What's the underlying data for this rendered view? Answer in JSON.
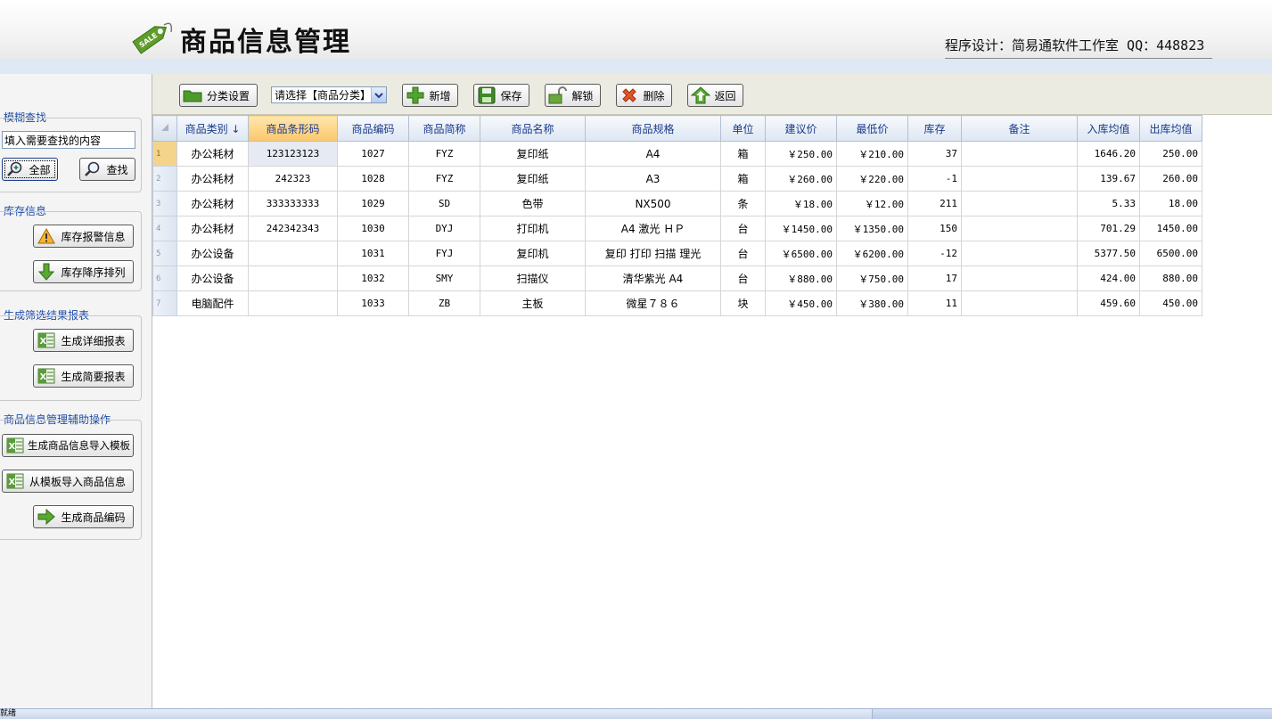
{
  "header": {
    "logo_text": "SALE",
    "title": "商品信息管理",
    "credit": "程序设计：简易通软件工作室 QQ：448823"
  },
  "sidebar": {
    "fuzzy_search": {
      "title": "模糊查找",
      "input_value": "填入需要查找的内容",
      "all_label": "全部",
      "search_label": "查找"
    },
    "stock_info": {
      "title": "库存信息",
      "alert_label": "库存报警信息",
      "sort_label": "库存降序排列"
    },
    "report": {
      "title": "生成筛选结果报表",
      "detail_label": "生成详细报表",
      "brief_label": "生成简要报表"
    },
    "aux": {
      "title": "商品信息管理辅助操作",
      "template_label": "生成商品信息导入模板",
      "import_label": "从模板导入商品信息",
      "barcode_label": "生成商品编码"
    }
  },
  "toolbar": {
    "category_setup": "分类设置",
    "category_select": "请选择【商品分类】",
    "add": "新增",
    "save": "保存",
    "unlock": "解锁",
    "delete": "删除",
    "back": "返回"
  },
  "grid": {
    "columns": [
      "商品类别 ↓",
      "商品条形码",
      "商品编码",
      "商品简称",
      "商品名称",
      "商品规格",
      "单位",
      "建议价",
      "最低价",
      "库存",
      "备注",
      "入库均值",
      "出库均值"
    ],
    "rows": [
      {
        "n": "1",
        "cat": "办公耗材",
        "barcode": "123123123",
        "code": "1027",
        "abbr": "FYZ",
        "name": "复印纸",
        "spec": "A4",
        "unit": "箱",
        "price": "￥250.00",
        "min": "￥210.00",
        "stock": "37",
        "note": "",
        "in_avg": "1646.20",
        "out_avg": "250.00"
      },
      {
        "n": "2",
        "cat": "办公耗材",
        "barcode": "242323",
        "code": "1028",
        "abbr": "FYZ",
        "name": "复印纸",
        "spec": "A3",
        "unit": "箱",
        "price": "￥260.00",
        "min": "￥220.00",
        "stock": "-1",
        "note": "",
        "in_avg": "139.67",
        "out_avg": "260.00"
      },
      {
        "n": "3",
        "cat": "办公耗材",
        "barcode": "333333333",
        "code": "1029",
        "abbr": "SD",
        "name": "色带",
        "spec": "NX500",
        "unit": "条",
        "price": "￥18.00",
        "min": "￥12.00",
        "stock": "211",
        "note": "",
        "in_avg": "5.33",
        "out_avg": "18.00"
      },
      {
        "n": "4",
        "cat": "办公耗材",
        "barcode": "242342343",
        "code": "1030",
        "abbr": "DYJ",
        "name": "打印机",
        "spec": "A4 激光 ＨＰ",
        "unit": "台",
        "price": "￥1450.00",
        "min": "￥1350.00",
        "stock": "150",
        "note": "",
        "in_avg": "701.29",
        "out_avg": "1450.00"
      },
      {
        "n": "5",
        "cat": "办公设备",
        "barcode": "",
        "code": "1031",
        "abbr": "FYJ",
        "name": "复印机",
        "spec": "复印  打印  扫描  理光",
        "unit": "台",
        "price": "￥6500.00",
        "min": "￥6200.00",
        "stock": "-12",
        "note": "",
        "in_avg": "5377.50",
        "out_avg": "6500.00"
      },
      {
        "n": "6",
        "cat": "办公设备",
        "barcode": "",
        "code": "1032",
        "abbr": "SMY",
        "name": "扫描仪",
        "spec": "清华紫光  A4",
        "unit": "台",
        "price": "￥880.00",
        "min": "￥750.00",
        "stock": "17",
        "note": "",
        "in_avg": "424.00",
        "out_avg": "880.00"
      },
      {
        "n": "7",
        "cat": "电脑配件",
        "barcode": "",
        "code": "1033",
        "abbr": "ZB",
        "name": "主板",
        "spec": "微星７８６",
        "unit": "块",
        "price": "￥450.00",
        "min": "￥380.00",
        "stock": "11",
        "note": "",
        "in_avg": "459.60",
        "out_avg": "450.00"
      }
    ]
  },
  "status": {
    "text": "就绪"
  },
  "colors": {
    "group_title": "#1a4aa8",
    "header_text": "#1a3a8a",
    "active_column": "#fbc76b"
  }
}
